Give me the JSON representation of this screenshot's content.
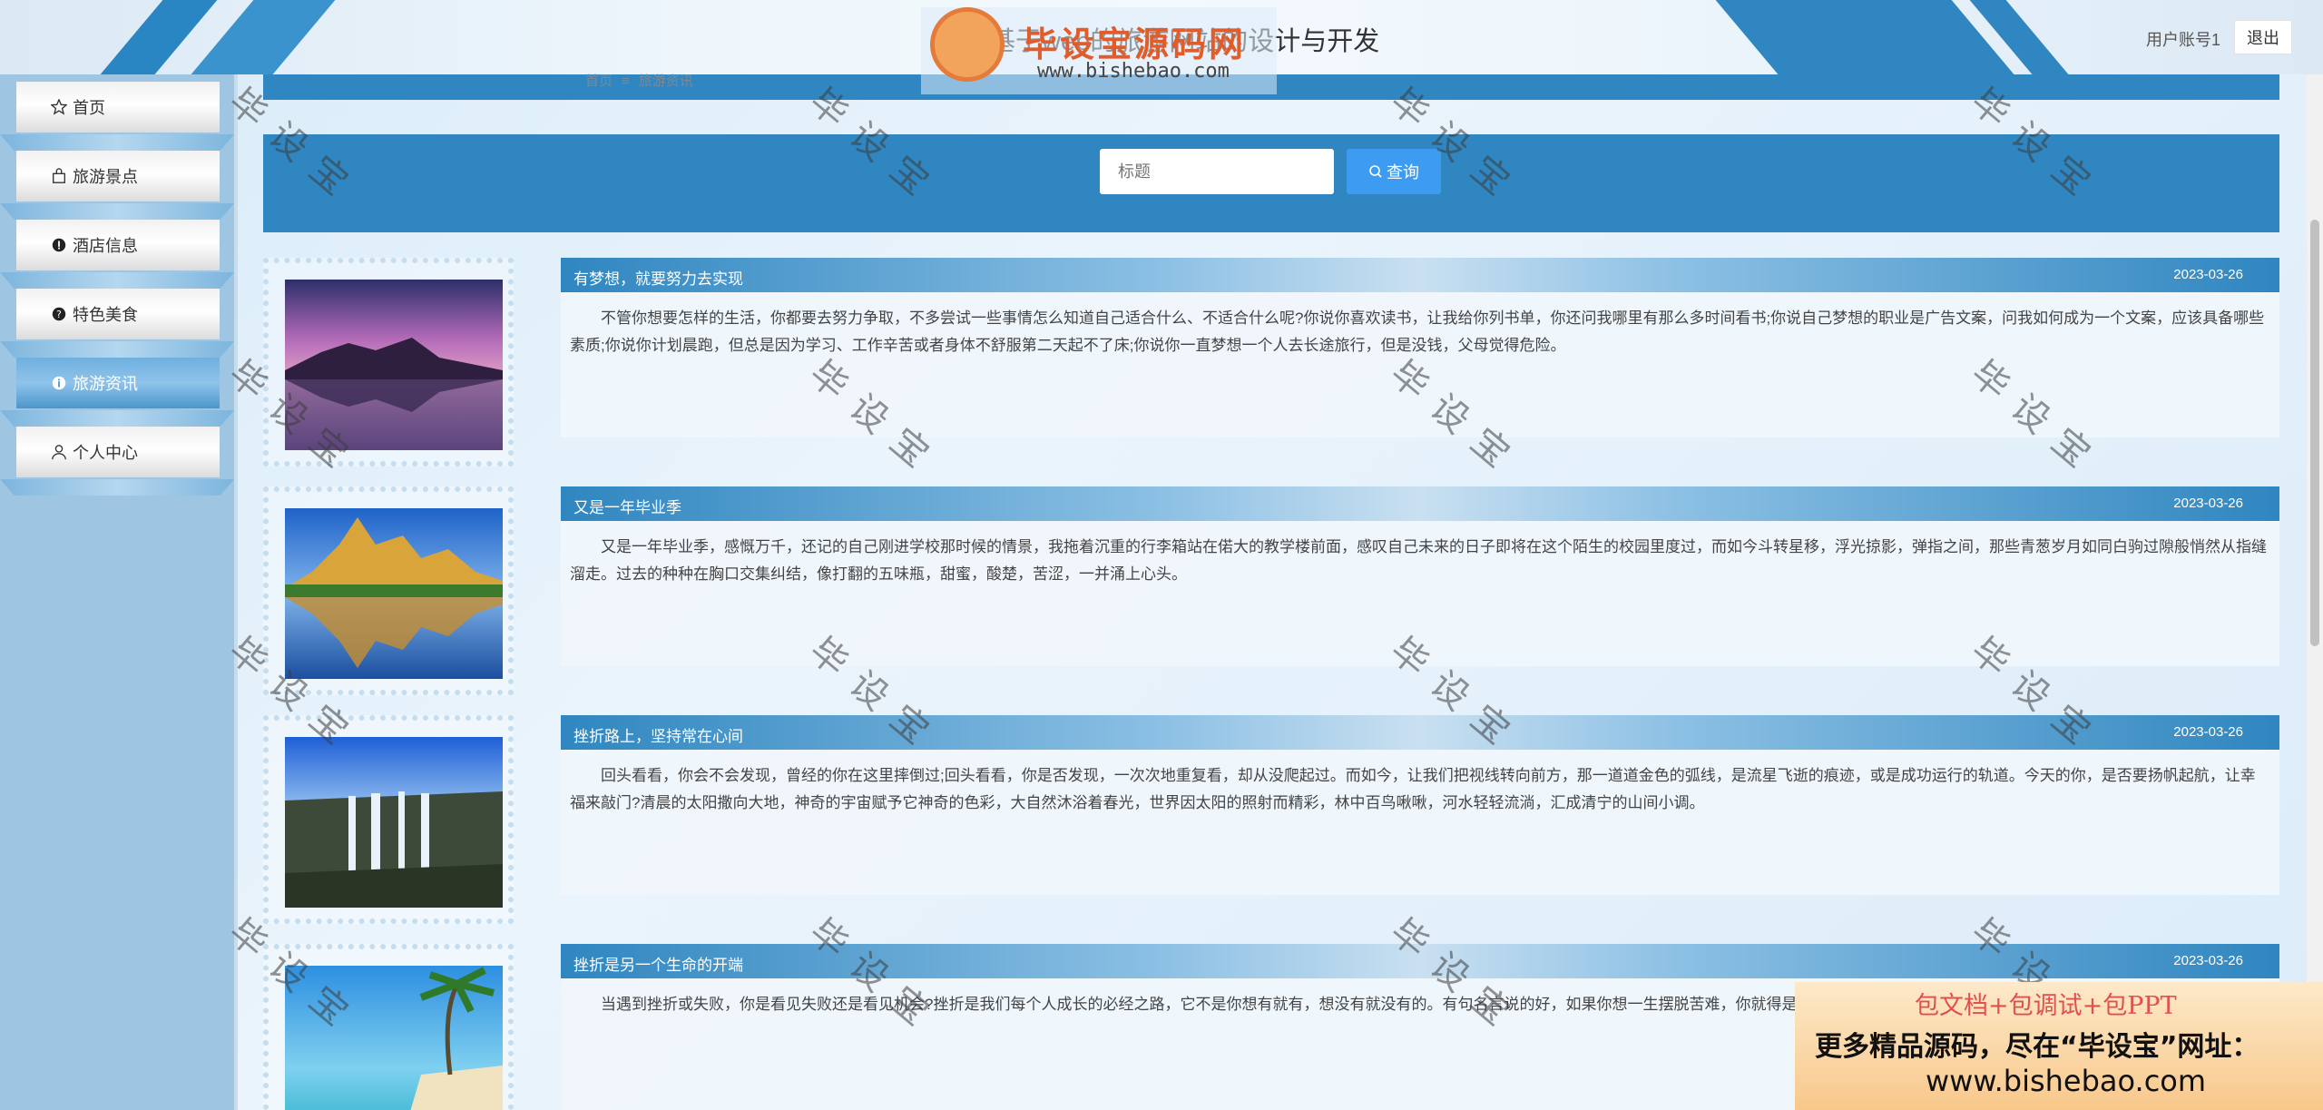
{
  "header": {
    "title": "基于web的旅游网站的设计与开发",
    "user_label": "用户账号1",
    "logout_label": "退出"
  },
  "logo": {
    "brand": "毕设宝源码网",
    "url": "www.bishebao.com"
  },
  "sidebar": {
    "items": [
      {
        "label": "首页",
        "icon": "star-icon"
      },
      {
        "label": "旅游景点",
        "icon": "bag-icon"
      },
      {
        "label": "酒店信息",
        "icon": "exclamation-icon"
      },
      {
        "label": "特色美食",
        "icon": "question-icon"
      },
      {
        "label": "旅游资讯",
        "icon": "info-icon",
        "active": true
      },
      {
        "label": "个人中心",
        "icon": "user-icon"
      }
    ]
  },
  "breadcrumb": {
    "home": "首页",
    "separator": "≡",
    "current": "旅游资讯"
  },
  "search": {
    "placeholder": "标题",
    "button_label": "查询"
  },
  "articles": [
    {
      "title": "有梦想，就要努力去实现",
      "date": "2023-03-26",
      "body": "不管你想要怎样的生活，你都要去努力争取，不多尝试一些事情怎么知道自己适合什么、不适合什么呢?你说你喜欢读书，让我给你列书单，你还问我哪里有那么多时间看书;你说自己梦想的职业是广告文案，问我如何成为一个文案，应该具备哪些素质;你说你计划晨跑，但总是因为学习、工作辛苦或者身体不舒服第二天起不了床;你说你一直梦想一个人去长途旅行，但是没钱，父母觉得危险。",
      "thumb": "purple-mountain-lake"
    },
    {
      "title": "又是一年毕业季",
      "date": "2023-03-26",
      "body": "又是一年毕业季，感慨万千，还记的自己刚进学校那时候的情景，我拖着沉重的行李箱站在偌大的教学楼前面，感叹自己未来的日子即将在这个陌生的校园里度过，而如今斗转星移，浮光掠影，弹指之间，那些青葱岁月如同白驹过隙般悄然从指缝溜走。过去的种种在胸口交集纠结，像打翻的五味瓶，甜蜜，酸楚，苦涩，一并涌上心头。",
      "thumb": "golden-mountain-lake"
    },
    {
      "title": "挫折路上，坚持常在心间",
      "date": "2023-03-26",
      "body": "回头看看，你会不会发现，曾经的你在这里摔倒过;回头看看，你是否发现，一次次地重复看，却从没爬起过。而如今，让我们把视线转向前方，那一道道金色的弧线，是流星飞逝的痕迹，或是成功运行的轨道。今天的你，是否要扬帆起航，让幸福来敲门?清晨的太阳撒向大地，神奇的宇宙赋予它神奇的色彩，大自然沐浴着春光，世界因太阳的照射而精彩，林中百鸟啾啾，河水轻轻流淌，汇成清宁的山间小调。",
      "thumb": "waterfall"
    },
    {
      "title": "挫折是另一个生命的开端",
      "date": "2023-03-26",
      "body": "当遇到挫折或失败，你是看见失败还是看见机会?挫折是我们每个人成长的必经之路，它不是你想有就有，想没有就没有的。有句名言说的好，如果你想一生摆脱苦难，你就得是神或者是死尸。这句话形象地说明了挫折是谁都逃不掉的。",
      "thumb": "tropical-beach"
    }
  ],
  "watermark": "毕设宝",
  "promo": {
    "line1": "包文档+包调试+包PPT",
    "line2": "更多精品源码，尽在“毕设宝”网址：",
    "line3": "www.bishebao.com"
  },
  "colors": {
    "primary": "#2f86c0",
    "button": "#3e9bf2",
    "sidebar_bg": "#9ec6e3"
  }
}
